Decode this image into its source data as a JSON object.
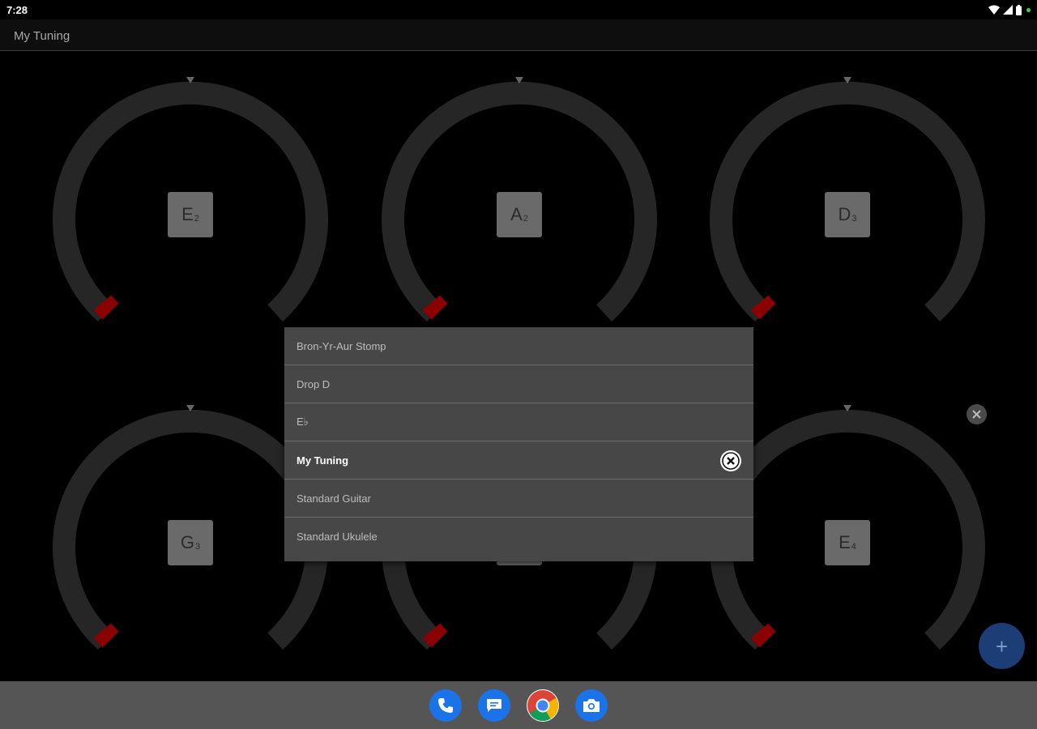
{
  "status_bar": {
    "time": "7:28"
  },
  "app": {
    "title": "My Tuning"
  },
  "strings": [
    {
      "note": "E",
      "octave": "2"
    },
    {
      "note": "A",
      "octave": "2"
    },
    {
      "note": "D",
      "octave": "3"
    },
    {
      "note": "G",
      "octave": "3"
    },
    {
      "note": "",
      "octave": ""
    },
    {
      "note": "E",
      "octave": "4"
    }
  ],
  "tuning_menu": {
    "items": [
      {
        "label": "Bron-Yr-Aur Stomp",
        "selected": false
      },
      {
        "label": "Drop D",
        "selected": false
      },
      {
        "label": "E♭",
        "selected": false
      },
      {
        "label": "My Tuning",
        "selected": true
      },
      {
        "label": "Standard Guitar",
        "selected": false
      },
      {
        "label": "Standard Ukulele",
        "selected": false
      }
    ]
  },
  "colors": {
    "dial_track": "#262626",
    "indicator": "#8b0000",
    "fab": "#1d3d77",
    "dock": "#555555"
  },
  "dock": {
    "apps": [
      {
        "name": "phone-icon"
      },
      {
        "name": "messages-icon"
      },
      {
        "name": "chrome-icon"
      },
      {
        "name": "camera-icon"
      }
    ]
  }
}
